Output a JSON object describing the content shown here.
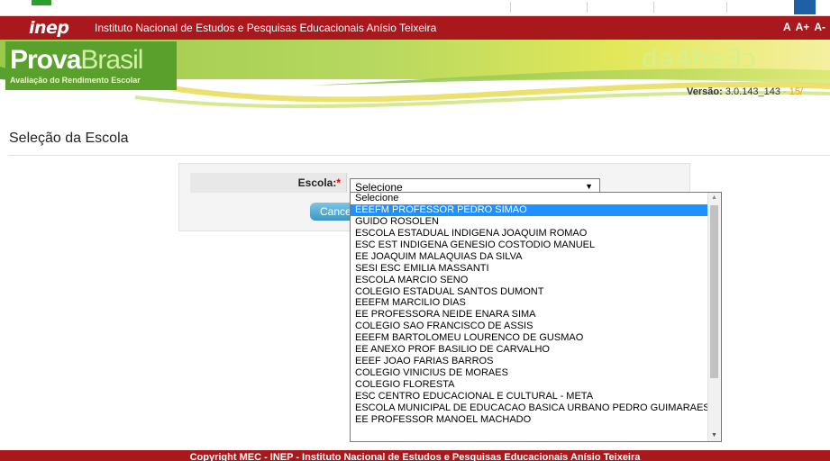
{
  "header": {
    "inep_logo": "inep",
    "institution_name": "Instituto Nacional de Estudos e Pesquisas Educacionais Anísio Teixeira",
    "font_controls": [
      "A",
      "A+",
      "A-"
    ]
  },
  "banner": {
    "title_bold": "Prova",
    "title_light": "Brasil",
    "subtitle": "Avaliação do Rendimento Escolar",
    "version_label": "Versão:",
    "version_value": "3.0.143_143",
    "version_date": "- 15/"
  },
  "page": {
    "title": "Seleção da Escola"
  },
  "form": {
    "escola_label": "Escola:",
    "required_mark": "*",
    "selected_value": "Selecione",
    "cancel_label": "Cancelar"
  },
  "dropdown": {
    "highlighted_index": 1,
    "options": [
      "Selecione",
      "EEEFM PROFESSOR PEDRO SIMAO",
      "GUIDO ROSOLEN",
      "ESCOLA ESTADUAL INDIGENA JOAQUIM ROMAO",
      "ESC EST INDIGENA GENESIO COSTODIO MANUEL",
      "EE JOAQUIM MALAQUIAS DA SILVA",
      "SESI ESC EMILIA MASSANTI",
      "ESCOLA MARCIO SENO",
      "COLEGIO ESTADUAL SANTOS DUMONT",
      "EEEFM MARCILIO DIAS",
      "EE PROFESSORA NEIDE ENARA SIMA",
      "COLEGIO SAO FRANCISCO DE ASSIS",
      "EEEFM BARTOLOMEU LOURENCO DE GUSMAO",
      "EE ANEXO PROF BASILIO DE CARVALHO",
      "EEEF JOAO FARIAS BARROS",
      "COLEGIO VINICIUS DE MORAES",
      "COLEGIO FLORESTA",
      "ESC CENTRO EDUCACIONAL E CULTURAL - META",
      "ESCOLA MUNICIPAL DE EDUCACAO BASICA URBANO PEDRO GUIMARAES",
      "EE PROFESSOR MANOEL MACHADO"
    ]
  },
  "footer": {
    "copyright": "Copyright MEC - INEP - Instituto Nacional de Estudos e Pesquisas Educacionais Anísio Teixeira"
  },
  "colors": {
    "inep_red": "#a8181c",
    "highlight_blue": "#1e90ff",
    "banner_green": "#5aa02c"
  }
}
